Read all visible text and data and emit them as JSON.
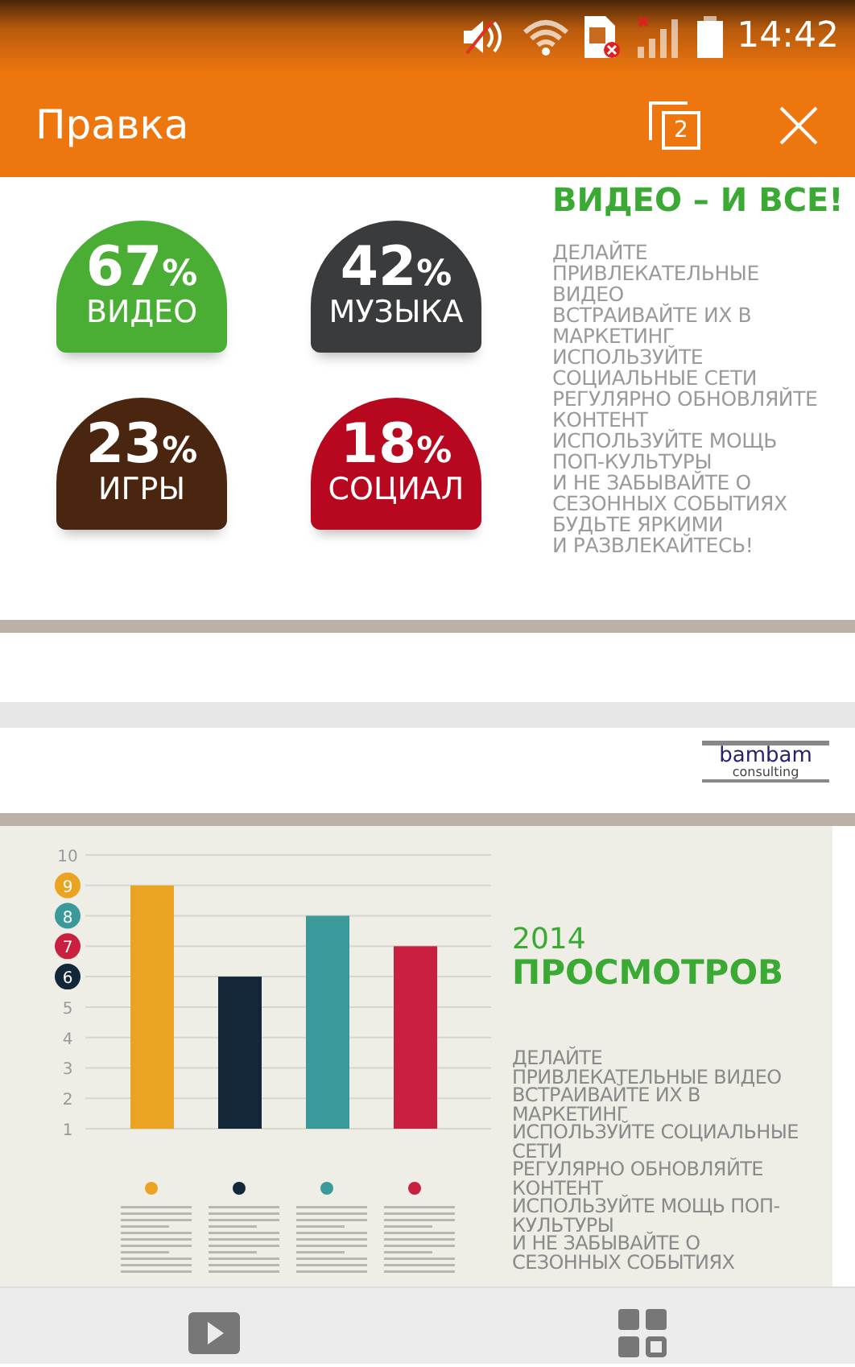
{
  "status_bar": {
    "time": "14:42"
  },
  "app_bar": {
    "title": "Правка",
    "tab_count": "2"
  },
  "slides": [
    {
      "kind": "stats",
      "headline": "ВИДЕО – И ВСЕ!",
      "stats": [
        {
          "value": "67",
          "unit": "%",
          "label": "ВИДЕО",
          "color": "#4aae35"
        },
        {
          "value": "42",
          "unit": "%",
          "label": "МУЗЫКА",
          "color": "#3a3b3d"
        },
        {
          "value": "23",
          "unit": "%",
          "label": "ИГРЫ",
          "color": "#4a250f"
        },
        {
          "value": "18",
          "unit": "%",
          "label": "СОЦИАЛ",
          "color": "#b8081f"
        }
      ],
      "body_lines": [
        "ДЕЛАЙТЕ",
        "ПРИВЛЕКАТЕЛЬНЫЕ",
        "ВИДЕО",
        "ВСТРАИВАЙТЕ ИХ В",
        "МАРКЕТИНГ",
        "ИСПОЛЬЗУЙТЕ",
        "СОЦИАЛЬНЫЕ СЕТИ",
        "РЕГУЛЯРНО ОБНОВЛЯЙТЕ",
        "КОНТЕНТ",
        "ИСПОЛЬЗУЙТЕ МОЩЬ",
        "ПОП-КУЛЬТУРЫ",
        "И НЕ ЗАБЫВАЙТЕ О",
        "СЕЗОННЫХ СОБЫТИЯХ",
        "БУДЬТЕ ЯРКИМИ",
        "И РАЗВЛЕКАЙТЕСЬ!"
      ]
    },
    {
      "kind": "logo",
      "logo_name": "bambam",
      "logo_sub": "consulting"
    },
    {
      "kind": "chart",
      "year": "2014",
      "headline": "ПРОСМОТРОВ",
      "chart_data": {
        "type": "bar",
        "ylim": [
          1,
          10
        ],
        "yticks": [
          1,
          2,
          3,
          4,
          5,
          6,
          7,
          8,
          9,
          10
        ],
        "grid": true,
        "series": [
          {
            "color": "#eba421",
            "values": [
              9
            ]
          },
          {
            "color": "#13263a",
            "values": [
              6
            ]
          },
          {
            "color": "#3a9a9a",
            "values": [
              8
            ]
          },
          {
            "color": "#c9203f",
            "values": [
              7
            ]
          }
        ]
      },
      "body_lines": [
        "ДЕЛАЙТЕ",
        "ПРИВЛЕКАТЕЛЬНЫЕ ВИДЕО",
        "ВСТРАИВАЙТЕ ИХ В",
        "МАРКЕТИНГ",
        "ИСПОЛЬЗУЙТЕ СОЦИАЛЬНЫЕ",
        "СЕТИ",
        "РЕГУЛЯРНО ОБНОВЛЯЙТЕ",
        "КОНТЕНТ",
        "ИСПОЛЬЗУЙТЕ МОЩЬ ПОП-",
        "КУЛЬТУРЫ",
        "И НЕ ЗАБЫВАЙТЕ О",
        "СЕЗОННЫХ СОБЫТИЯХ"
      ]
    }
  ],
  "bottom_bar": [
    {
      "kind": "play"
    },
    {
      "kind": "grid"
    }
  ]
}
